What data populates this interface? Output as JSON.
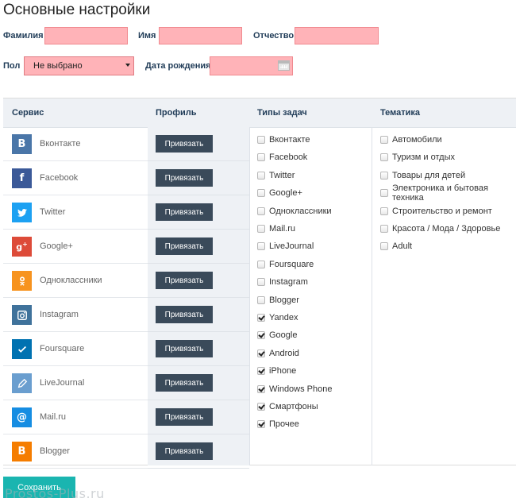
{
  "header": {
    "title": "Основные настройки"
  },
  "form": {
    "last_name_label": "Фамилия",
    "first_name_label": "Имя",
    "middle_name_label": "Отчество",
    "gender_label": "Пол",
    "gender_value": "Не выбрано",
    "birthdate_label": "Дата рождения"
  },
  "table": {
    "headers": {
      "service": "Сервис",
      "profile": "Профиль",
      "task_types": "Типы задач",
      "topics": "Тематика"
    },
    "bind_label": "Привязать",
    "services": [
      {
        "name": "Вконтакте",
        "icon": "vk-icon",
        "glyph": "B",
        "color": "#4a76a8"
      },
      {
        "name": "Facebook",
        "icon": "facebook-icon",
        "glyph": "f",
        "color": "#3b5998"
      },
      {
        "name": "Twitter",
        "icon": "twitter-icon",
        "glyph": "bird",
        "color": "#1da1f2"
      },
      {
        "name": "Google+",
        "icon": "google-plus-icon",
        "glyph": "g+",
        "color": "#dd4b39"
      },
      {
        "name": "Одноклассники",
        "icon": "odnoklassniki-icon",
        "glyph": "ok",
        "color": "#f7931e"
      },
      {
        "name": "Instagram",
        "icon": "instagram-icon",
        "glyph": "cam",
        "color": "#3f729b"
      },
      {
        "name": "Foursquare",
        "icon": "foursquare-icon",
        "glyph": "check",
        "color": "#0072b1"
      },
      {
        "name": "LiveJournal",
        "icon": "livejournal-icon",
        "glyph": "pen",
        "color": "#6a9ecf"
      },
      {
        "name": "Mail.ru",
        "icon": "mailru-icon",
        "glyph": "@",
        "color": "#168de2"
      },
      {
        "name": "Blogger",
        "icon": "blogger-icon",
        "glyph": "B",
        "color": "#f57d00"
      }
    ],
    "task_types": [
      {
        "label": "Вконтакте",
        "checked": false
      },
      {
        "label": "Facebook",
        "checked": false
      },
      {
        "label": "Twitter",
        "checked": false
      },
      {
        "label": "Google+",
        "checked": false
      },
      {
        "label": "Одноклассники",
        "checked": false
      },
      {
        "label": "Mail.ru",
        "checked": false
      },
      {
        "label": "LiveJournal",
        "checked": false
      },
      {
        "label": "Foursquare",
        "checked": false
      },
      {
        "label": "Instagram",
        "checked": false
      },
      {
        "label": "Blogger",
        "checked": false
      },
      {
        "label": "Yandex",
        "checked": true
      },
      {
        "label": "Google",
        "checked": true
      },
      {
        "label": "Android",
        "checked": true
      },
      {
        "label": "iPhone",
        "checked": true
      },
      {
        "label": "Windows Phone",
        "checked": true
      },
      {
        "label": "Смартфоны",
        "checked": true
      },
      {
        "label": "Прочее",
        "checked": true
      }
    ],
    "topics": [
      {
        "label": "Автомобили",
        "checked": false
      },
      {
        "label": "Туризм и отдых",
        "checked": false
      },
      {
        "label": "Товары для детей",
        "checked": false
      },
      {
        "label": "Электроника и бытовая техника",
        "checked": false
      },
      {
        "label": "Строительство и ремонт",
        "checked": false
      },
      {
        "label": "Красота / Мода / Здоровье",
        "checked": false
      },
      {
        "label": "Adult",
        "checked": false
      }
    ]
  },
  "footer": {
    "save_label": "Сохранить",
    "watermark": "Prostos-Plus.ru"
  }
}
